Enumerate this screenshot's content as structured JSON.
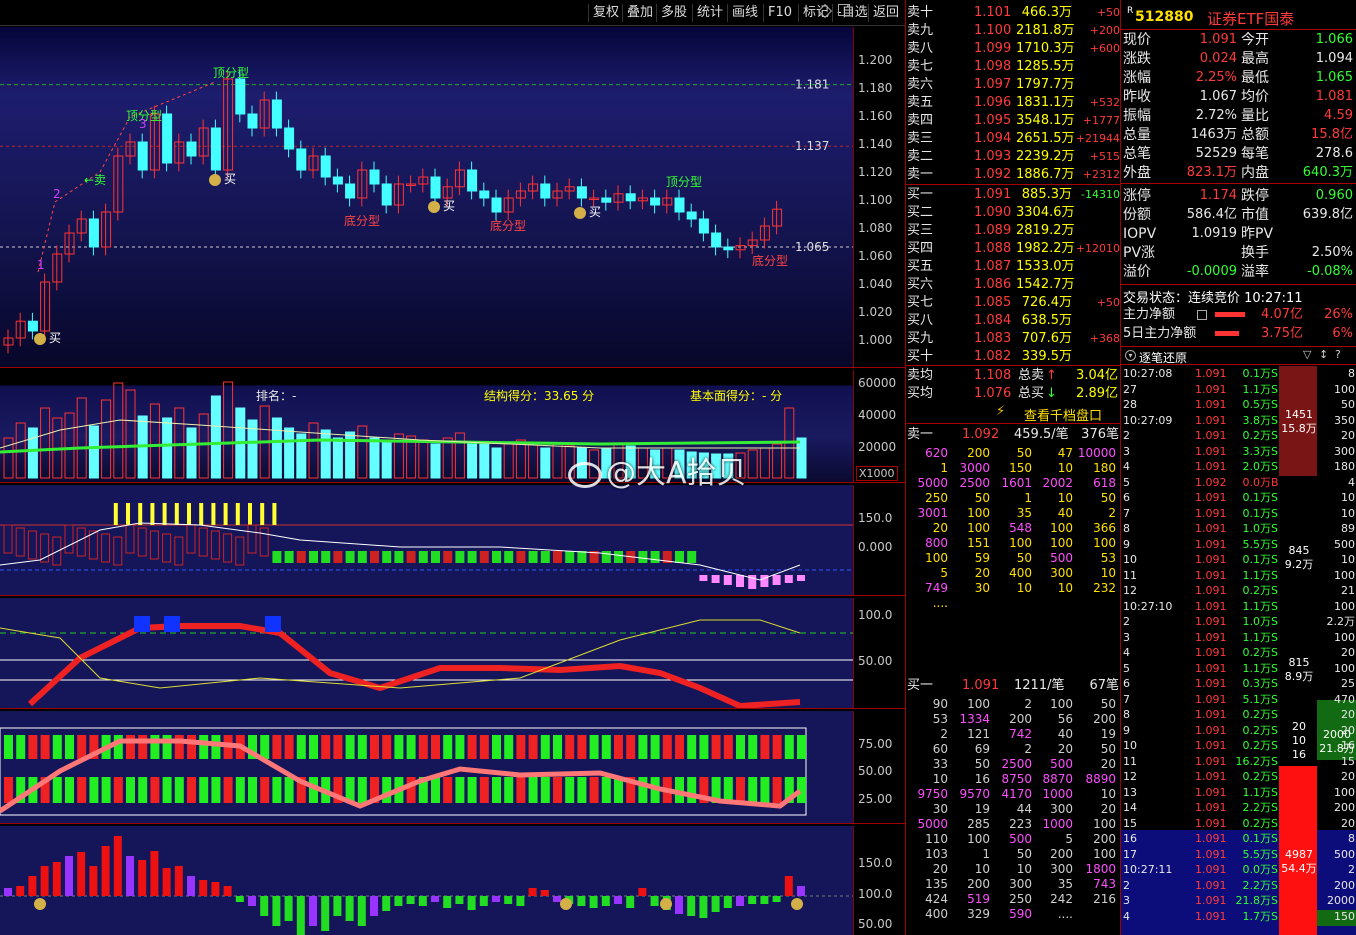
{
  "toolbar": {
    "buttons": [
      "复权",
      "叠加",
      "多股",
      "统计",
      "画线",
      "F10",
      "标记",
      "-自选",
      "返回"
    ]
  },
  "kline": {
    "labels": {
      "top1": "顶分型",
      "top2": "顶分型",
      "top3": "顶分型",
      "bot1": "底分型",
      "bot2": "底分型",
      "bot3": "底分型",
      "buy": "买",
      "sell": "←卖",
      "n1": "1",
      "n2": "2",
      "n3": "3"
    },
    "price_lines": [
      "1.181",
      "1.137",
      "1.065"
    ],
    "axis": [
      "1.200",
      "1.180",
      "1.160",
      "1.140",
      "1.120",
      "1.100",
      "1.080",
      "1.060",
      "1.040",
      "1.020",
      "1.000"
    ]
  },
  "vol_panel": {
    "rank": "排名：-",
    "struct": "结构得分：33.65 分",
    "basic": "基本面得分：- 分",
    "axis": [
      "60000",
      "40000",
      "20000"
    ],
    "unit": "X1000"
  },
  "ind2_axis": [
    "150.0",
    "0.000"
  ],
  "ind3_axis": [
    "100.0",
    "50.00"
  ],
  "ind4_axis": [
    "75.00",
    "50.00",
    "25.00"
  ],
  "ind5_axis": [
    "150.0",
    "100.0",
    "50.00"
  ],
  "watermark": "@大A拾贝",
  "order_book": {
    "asks": [
      [
        "卖十",
        "1.101",
        "466.3万",
        "+50"
      ],
      [
        "卖九",
        "1.100",
        "2181.8万",
        "+200"
      ],
      [
        "卖八",
        "1.099",
        "1710.3万",
        "+600"
      ],
      [
        "卖七",
        "1.098",
        "1285.5万",
        ""
      ],
      [
        "卖六",
        "1.097",
        "1797.7万",
        ""
      ],
      [
        "卖五",
        "1.096",
        "1831.1万",
        "+532"
      ],
      [
        "卖四",
        "1.095",
        "3548.1万",
        "+1777"
      ],
      [
        "卖三",
        "1.094",
        "2651.5万",
        "+21944"
      ],
      [
        "卖二",
        "1.093",
        "2239.2万",
        "+515"
      ],
      [
        "卖一",
        "1.092",
        "1886.7万",
        "+2312"
      ]
    ],
    "bids": [
      [
        "买一",
        "1.091",
        "885.3万",
        "-14310"
      ],
      [
        "买二",
        "1.090",
        "3304.6万",
        ""
      ],
      [
        "买三",
        "1.089",
        "2819.2万",
        ""
      ],
      [
        "买四",
        "1.088",
        "1982.2万",
        "+12010"
      ],
      [
        "买五",
        "1.087",
        "1533.0万",
        ""
      ],
      [
        "买六",
        "1.086",
        "1542.7万",
        ""
      ],
      [
        "买七",
        "1.085",
        "726.4万",
        "+50"
      ],
      [
        "买八",
        "1.084",
        "638.5万",
        ""
      ],
      [
        "买九",
        "1.083",
        "707.6万",
        "+368"
      ],
      [
        "买十",
        "1.082",
        "339.5万",
        ""
      ]
    ],
    "avg": [
      [
        "卖均",
        "1.108",
        "总卖",
        "3.04亿"
      ],
      [
        "买均",
        "1.076",
        "总买",
        "2.89亿"
      ]
    ],
    "view_depth": "查看千档盘口",
    "ask1_head": [
      "卖一",
      "1.092",
      "459.5/笔",
      "376笔"
    ],
    "ask1_queue": [
      [
        "620",
        "200",
        "50",
        "47",
        "10000"
      ],
      [
        "1",
        "3000",
        "150",
        "10",
        "180"
      ],
      [
        "5000",
        "2500",
        "1601",
        "2002",
        "618"
      ],
      [
        "250",
        "50",
        "1",
        "10",
        "50"
      ],
      [
        "3001",
        "100",
        "35",
        "40",
        "2"
      ],
      [
        "20",
        "100",
        "548",
        "100",
        "366"
      ],
      [
        "800",
        "151",
        "100",
        "100",
        "100"
      ],
      [
        "100",
        "59",
        "50",
        "500",
        "53"
      ],
      [
        "5",
        "20",
        "400",
        "300",
        "10"
      ],
      [
        "749",
        "30",
        "10",
        "10",
        "232"
      ],
      [
        "....",
        "",
        "",
        "",
        ""
      ]
    ],
    "bid1_head": [
      "买一",
      "1.091",
      "1211/笔",
      "67笔"
    ],
    "bid1_queue": [
      [
        "90",
        "100",
        "2",
        "100",
        "50"
      ],
      [
        "53",
        "1334",
        "200",
        "56",
        "200"
      ],
      [
        "2",
        "121",
        "742",
        "40",
        "19"
      ],
      [
        "60",
        "69",
        "2",
        "20",
        "50"
      ],
      [
        "33",
        "50",
        "2500",
        "500",
        "20"
      ],
      [
        "10",
        "16",
        "8750",
        "8870",
        "8890"
      ],
      [
        "9750",
        "9570",
        "4170",
        "1000",
        "10"
      ],
      [
        "30",
        "19",
        "44",
        "300",
        "20"
      ],
      [
        "5000",
        "285",
        "223",
        "1000",
        "100"
      ],
      [
        "110",
        "100",
        "500",
        "5",
        "200"
      ],
      [
        "103",
        "1",
        "50",
        "200",
        "100"
      ],
      [
        "20",
        "10",
        "10",
        "300",
        "1800"
      ],
      [
        "135",
        "200",
        "300",
        "35",
        "743"
      ],
      [
        "424",
        "519",
        "250",
        "242",
        "216"
      ],
      [
        "400",
        "329",
        "590",
        "....",
        ""
      ]
    ]
  },
  "quote": {
    "code": "512880",
    "name": "证券ETF国泰",
    "rows": [
      [
        "现价",
        "1.091",
        "今开",
        "1.066"
      ],
      [
        "涨跌",
        "0.024",
        "最高",
        "1.094"
      ],
      [
        "涨幅",
        "2.25%",
        "最低",
        "1.065"
      ],
      [
        "昨收",
        "1.067",
        "均价",
        "1.081"
      ],
      [
        "振幅",
        "2.72%",
        "量比",
        "4.59"
      ],
      [
        "总量",
        "1463万",
        "总额",
        "15.8亿"
      ],
      [
        "总笔",
        "52529",
        "每笔",
        "278.6"
      ],
      [
        "外盘",
        "823.1万",
        "内盘",
        "640.3万"
      ],
      [
        "涨停",
        "1.174",
        "跌停",
        "0.960"
      ],
      [
        "份额",
        "586.4亿",
        "市值",
        "639.8亿"
      ],
      [
        "IOPV",
        "1.0919",
        "昨PV",
        ""
      ],
      [
        "PV涨",
        "",
        "换手",
        "2.50%"
      ],
      [
        "溢价",
        "-0.0009",
        "溢率",
        "-0.08%"
      ]
    ],
    "status": "交易状态：连续竞价 10:27:11",
    "main_net": [
      "主力净额",
      "4.07亿",
      "26%"
    ],
    "main_net5": [
      "5日主力净额",
      "3.75亿",
      "6%"
    ],
    "tick_title": "逐笔还原"
  },
  "ticks": [
    [
      "10:27:08",
      "1.091",
      "0.1万",
      "S",
      "8"
    ],
    [
      "27",
      "1.091",
      "1.1万",
      "S",
      "100"
    ],
    [
      "28",
      "1.091",
      "0.5万",
      "S",
      "50"
    ],
    [
      "10:27:09",
      "1.091",
      "3.8万",
      "S",
      "350"
    ],
    [
      "2",
      "1.091",
      "0.2万",
      "S",
      "20"
    ],
    [
      "3",
      "1.091",
      "3.3万",
      "S",
      "300"
    ],
    [
      "4",
      "1.091",
      "2.0万",
      "S",
      "180"
    ],
    [
      "5",
      "1.092",
      "0.0万",
      "B",
      "4"
    ],
    [
      "6",
      "1.091",
      "0.1万",
      "S",
      "10"
    ],
    [
      "7",
      "1.091",
      "0.1万",
      "S",
      "10"
    ],
    [
      "8",
      "1.091",
      "1.0万",
      "S",
      "89"
    ],
    [
      "9",
      "1.091",
      "5.5万",
      "S",
      "500"
    ],
    [
      "10",
      "1.091",
      "0.1万",
      "S",
      "10"
    ],
    [
      "11",
      "1.091",
      "1.1万",
      "S",
      "100"
    ],
    [
      "12",
      "1.091",
      "0.2万",
      "S",
      "21"
    ],
    [
      "10:27:10",
      "1.091",
      "1.1万",
      "S",
      "100"
    ],
    [
      "2",
      "1.091",
      "1.0万",
      "S",
      "2.2万"
    ],
    [
      "3",
      "1.091",
      "1.1万",
      "S",
      "100"
    ],
    [
      "4",
      "1.091",
      "0.2万",
      "S",
      "20"
    ],
    [
      "5",
      "1.091",
      "1.1万",
      "S",
      "100"
    ],
    [
      "6",
      "1.091",
      "0.3万",
      "S",
      "25"
    ],
    [
      "7",
      "1.091",
      "5.1万",
      "S",
      "470"
    ],
    [
      "8",
      "1.091",
      "0.2万",
      "S",
      "20"
    ],
    [
      "9",
      "1.091",
      "0.2万",
      "S",
      "20"
    ],
    [
      "10",
      "1.091",
      "0.2万",
      "S",
      "16"
    ],
    [
      "11",
      "1.091",
      "16.2万",
      "S",
      "15"
    ],
    [
      "12",
      "1.091",
      "0.2万",
      "S",
      "20"
    ],
    [
      "13",
      "1.091",
      "1.1万",
      "S",
      "100"
    ],
    [
      "14",
      "1.091",
      "2.2万",
      "S",
      "200"
    ],
    [
      "15",
      "1.091",
      "0.2万",
      "S",
      "20"
    ],
    [
      "16",
      "1.091",
      "0.1万",
      "S",
      "8"
    ],
    [
      "17",
      "1.091",
      "5.5万",
      "S",
      "500"
    ],
    [
      "10:27:11",
      "1.091",
      "0.0万",
      "S",
      "2"
    ],
    [
      "2",
      "1.091",
      "2.2万",
      "S",
      "200"
    ],
    [
      "3",
      "1.091",
      "21.8万",
      "S",
      "2000"
    ],
    [
      "4",
      "1.091",
      "1.7万",
      "S",
      "150"
    ]
  ],
  "tick_blocks": [
    [
      "1451",
      "15.8万"
    ],
    [
      "845",
      "9.2万"
    ],
    [
      "815",
      "8.9万"
    ],
    [
      "20",
      "10",
      "16"
    ],
    [
      "2000",
      "21.8万"
    ],
    [
      "4987",
      "54.4万"
    ]
  ]
}
